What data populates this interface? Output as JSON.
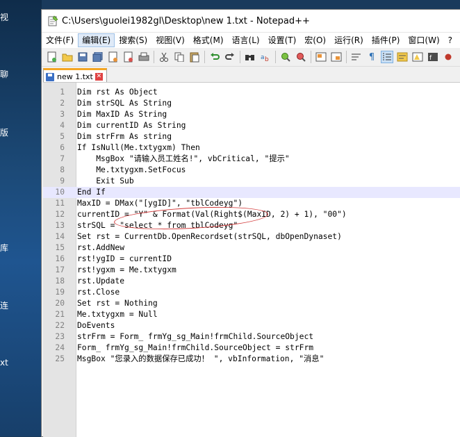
{
  "desktop": {
    "labels": [
      "视",
      "聊",
      "版",
      "库",
      "连",
      "xt"
    ]
  },
  "window": {
    "title": "C:\\Users\\guolei1982gl\\Desktop\\new 1.txt - Notepad++",
    "menu": [
      "文件(F)",
      "编辑(E)",
      "搜索(S)",
      "视图(V)",
      "格式(M)",
      "语言(L)",
      "设置(T)",
      "宏(O)",
      "运行(R)",
      "插件(P)",
      "窗口(W)",
      "?"
    ],
    "active_menu_index": 1,
    "tab": {
      "label": "new 1.txt",
      "close": "✕"
    },
    "current_line": 10
  },
  "editor": {
    "lines": [
      {
        "n": "1",
        "text": "Dim rst As Object"
      },
      {
        "n": "2",
        "text": "Dim strSQL As String"
      },
      {
        "n": "3",
        "text": "Dim MaxID As String"
      },
      {
        "n": "4",
        "text": "Dim currentID As String"
      },
      {
        "n": "5",
        "text": "Dim strFrm As string"
      },
      {
        "n": "6",
        "text": "If IsNull(Me.txtygxm) Then"
      },
      {
        "n": "7",
        "text": "    MsgBox \"请输入员工姓名!\", vbCritical, \"提示\""
      },
      {
        "n": "8",
        "text": "    Me.txtygxm.SetFocus"
      },
      {
        "n": "9",
        "text": "    Exit Sub"
      },
      {
        "n": "10",
        "text": "End If"
      },
      {
        "n": "11",
        "text": "MaxID = DMax(\"[ygID]\", \"tblCodeyg\")"
      },
      {
        "n": "12",
        "text": "currentID = \"Y\" & Format(Val(Right$(MaxID, 2) + 1), \"00\")"
      },
      {
        "n": "13",
        "text": "strSQL = \"select * from tblCodeyg\""
      },
      {
        "n": "14",
        "text": "Set rst = CurrentDb.OpenRecordset(strSQL, dbOpenDynaset)"
      },
      {
        "n": "15",
        "text": "rst.AddNew"
      },
      {
        "n": "16",
        "text": "rst!ygID = currentID"
      },
      {
        "n": "17",
        "text": "rst!ygxm = Me.txtygxm"
      },
      {
        "n": "18",
        "text": "rst.Update"
      },
      {
        "n": "19",
        "text": "rst.Close"
      },
      {
        "n": "20",
        "text": "Set rst = Nothing"
      },
      {
        "n": "21",
        "text": "Me.txtygxm = Null"
      },
      {
        "n": "22",
        "text": "DoEvents"
      },
      {
        "n": "23",
        "text": "strFrm = Form_ frmYg_sg_Main!frmChild.SourceObject"
      },
      {
        "n": "24",
        "text": "Form_ frmYg_sg_Main!frmChild.SourceObject = strFrm"
      },
      {
        "n": "25",
        "text": "MsgBox \"您录入的数据保存已成功！ \", vbInformation, \"消息\""
      }
    ]
  }
}
